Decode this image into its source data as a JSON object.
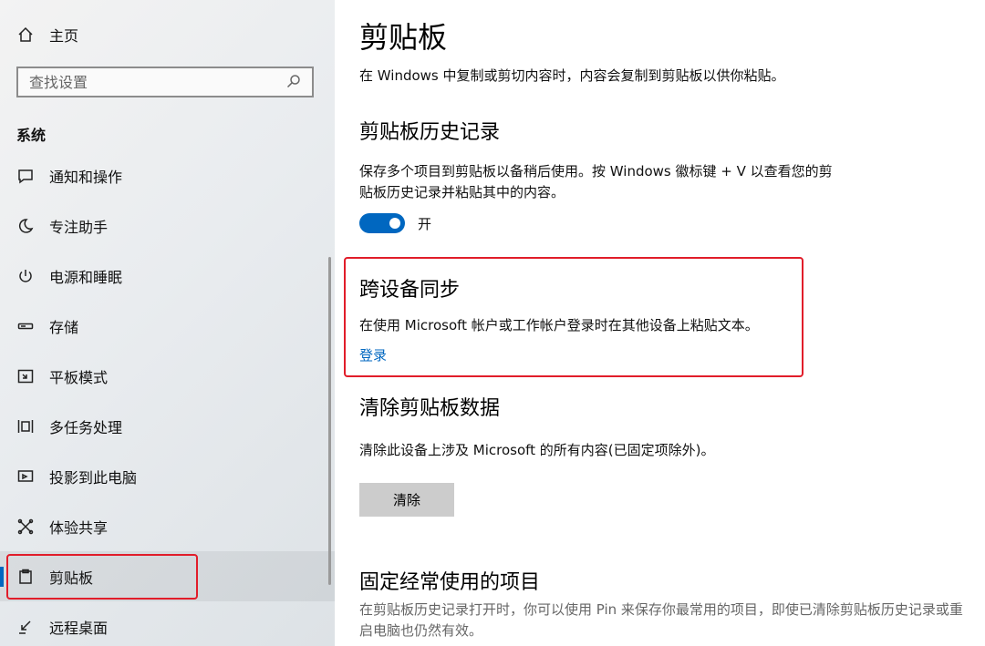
{
  "sidebar": {
    "home_label": "主页",
    "search_placeholder": "查找设置",
    "section_title": "系统",
    "items": [
      {
        "label": "通知和操作",
        "icon": "notification-icon"
      },
      {
        "label": "专注助手",
        "icon": "moon-icon"
      },
      {
        "label": "电源和睡眠",
        "icon": "power-icon"
      },
      {
        "label": "存储",
        "icon": "storage-icon"
      },
      {
        "label": "平板模式",
        "icon": "tablet-icon"
      },
      {
        "label": "多任务处理",
        "icon": "multitask-icon"
      },
      {
        "label": "投影到此电脑",
        "icon": "project-icon"
      },
      {
        "label": "体验共享",
        "icon": "share-icon"
      },
      {
        "label": "剪贴板",
        "icon": "clipboard-icon",
        "active": true
      },
      {
        "label": "远程桌面",
        "icon": "remote-desktop-icon"
      }
    ]
  },
  "main": {
    "title": "剪贴板",
    "description": "在 Windows 中复制或剪切内容时，内容会复制到剪贴板以供你粘贴。",
    "history": {
      "heading": "剪贴板历史记录",
      "description": "保存多个项目到剪贴板以备稍后使用。按 Windows 徽标键 + V 以查看您的剪贴板历史记录并粘贴其中的内容。",
      "toggle_label": "开",
      "toggle_on": true
    },
    "sync": {
      "heading": "跨设备同步",
      "description": "在使用 Microsoft 帐户或工作帐户登录时在其他设备上粘贴文本。",
      "link": "登录"
    },
    "clear": {
      "heading": "清除剪贴板数据",
      "description": "清除此设备上涉及 Microsoft 的所有内容(已固定项除外)。",
      "button": "清除"
    },
    "pinned": {
      "heading": "固定经常使用的项目",
      "description": "在剪贴板历史记录打开时，你可以使用 Pin 来保存你最常用的项目，即使已清除剪贴板历史记录或重启电脑也仍然有效。"
    }
  },
  "colors": {
    "accent": "#0067c0",
    "highlight": "#e11d2a"
  }
}
